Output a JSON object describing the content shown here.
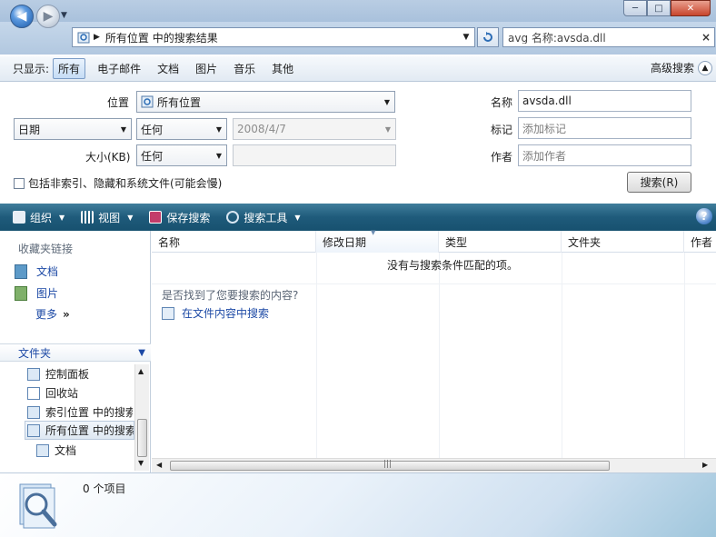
{
  "window": {
    "minimize": "─",
    "maximize": "□",
    "close": "✕"
  },
  "nav": {
    "back": "◀",
    "forward": "▶",
    "address_text": "所有位置 中的搜索结果",
    "search_value": "avg 名称:avsda.dll"
  },
  "filter": {
    "label": "只显示:",
    "items": [
      "所有",
      "电子邮件",
      "文档",
      "图片",
      "音乐",
      "其他"
    ],
    "advanced": "高级搜索"
  },
  "advanced": {
    "location_label": "位置",
    "location_value": "所有位置",
    "date_field": "日期",
    "date_cond": "任何",
    "date_value": "2008/4/7",
    "size_label": "大小(KB)",
    "size_cond": "任何",
    "size_value": "",
    "name_label": "名称",
    "name_value": "avsda.dll",
    "tags_label": "标记",
    "tags_placeholder": "添加标记",
    "author_label": "作者",
    "author_placeholder": "添加作者",
    "include_label": "包括非索引、隐藏和系统文件(可能会慢)",
    "search_button": "搜索(R)"
  },
  "toolbar": {
    "organize": "组织",
    "views": "视图",
    "save_search": "保存搜索",
    "search_tools": "搜索工具",
    "help": "?"
  },
  "left": {
    "favorites_title": "收藏夹链接",
    "favorites": [
      "文档",
      "图片"
    ],
    "more": "更多",
    "folders_title": "文件夹",
    "tree": [
      "控制面板",
      "回收站",
      "索引位置 中的搜索",
      "所有位置 中的搜索",
      "文档"
    ]
  },
  "list": {
    "columns": [
      "名称",
      "修改日期",
      "类型",
      "文件夹",
      "作者"
    ],
    "empty_message": "没有与搜索条件匹配的项。",
    "not_found_prompt": "是否找到了您要搜索的内容?",
    "search_in_content": "在文件内容中搜索"
  },
  "details": {
    "item_count": "0 个项目"
  },
  "colors": {
    "toolbar": "#1f5b7b",
    "link": "#1c49a5"
  }
}
